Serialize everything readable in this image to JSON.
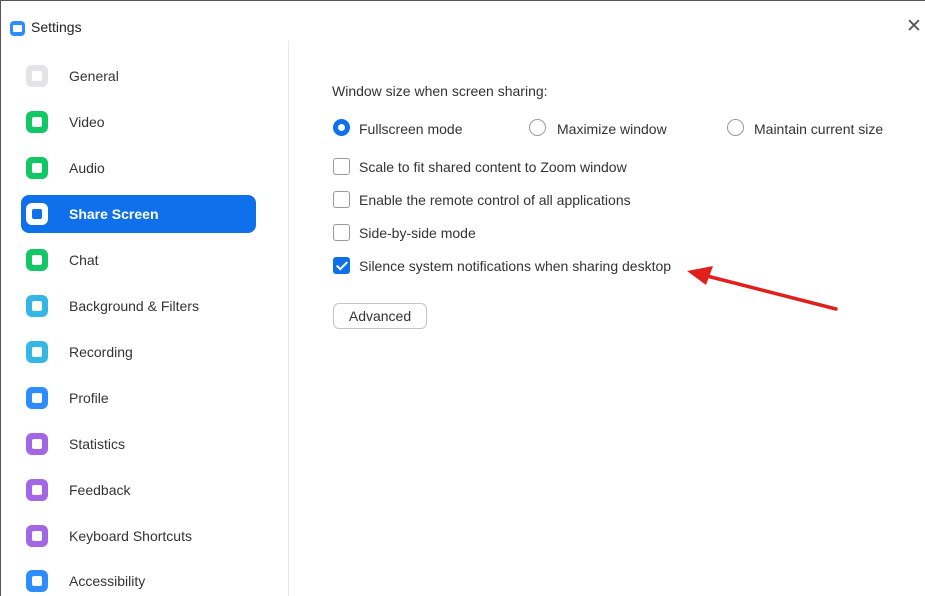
{
  "window": {
    "title": "Settings",
    "close_glyph": "✕"
  },
  "sidebar": {
    "items": [
      {
        "label": "General",
        "icon": "gear-icon",
        "color": "#E4E4E7",
        "active": false
      },
      {
        "label": "Video",
        "icon": "video-camera-icon",
        "color": "#12C765",
        "active": false
      },
      {
        "label": "Audio",
        "icon": "headphones-icon",
        "color": "#12C765",
        "active": false
      },
      {
        "label": "Share Screen",
        "icon": "share-screen-icon",
        "color": "#0E71EB",
        "active": true
      },
      {
        "label": "Chat",
        "icon": "chat-bubble-icon",
        "color": "#12C765",
        "active": false
      },
      {
        "label": "Background & Filters",
        "icon": "background-icon",
        "color": "#35B7E5",
        "active": false
      },
      {
        "label": "Recording",
        "icon": "record-icon",
        "color": "#35B7E5",
        "active": false
      },
      {
        "label": "Profile",
        "icon": "user-icon",
        "color": "#2D8CFF",
        "active": false
      },
      {
        "label": "Statistics",
        "icon": "bar-chart-icon",
        "color": "#A367E6",
        "active": false
      },
      {
        "label": "Feedback",
        "icon": "smiley-icon",
        "color": "#A367E6",
        "active": false
      },
      {
        "label": "Keyboard Shortcuts",
        "icon": "keyboard-icon",
        "color": "#A367E6",
        "active": false
      },
      {
        "label": "Accessibility",
        "icon": "accessibility-icon",
        "color": "#2D8CFF",
        "active": false
      }
    ]
  },
  "share_screen": {
    "window_size_label": "Window size when screen sharing:",
    "window_size_options": [
      {
        "label": "Fullscreen mode",
        "selected": true
      },
      {
        "label": "Maximize window",
        "selected": false
      },
      {
        "label": "Maintain current size",
        "selected": false
      }
    ],
    "options": [
      {
        "label": "Scale to fit shared content to Zoom window",
        "checked": false
      },
      {
        "label": "Enable the remote control of all applications",
        "checked": false
      },
      {
        "label": "Side-by-side mode",
        "checked": false
      },
      {
        "label": "Silence system notifications when sharing desktop",
        "checked": true
      }
    ],
    "advanced_label": "Advanced"
  },
  "colors": {
    "accent": "#0E71EB",
    "annotation_arrow": "#E0211B"
  }
}
